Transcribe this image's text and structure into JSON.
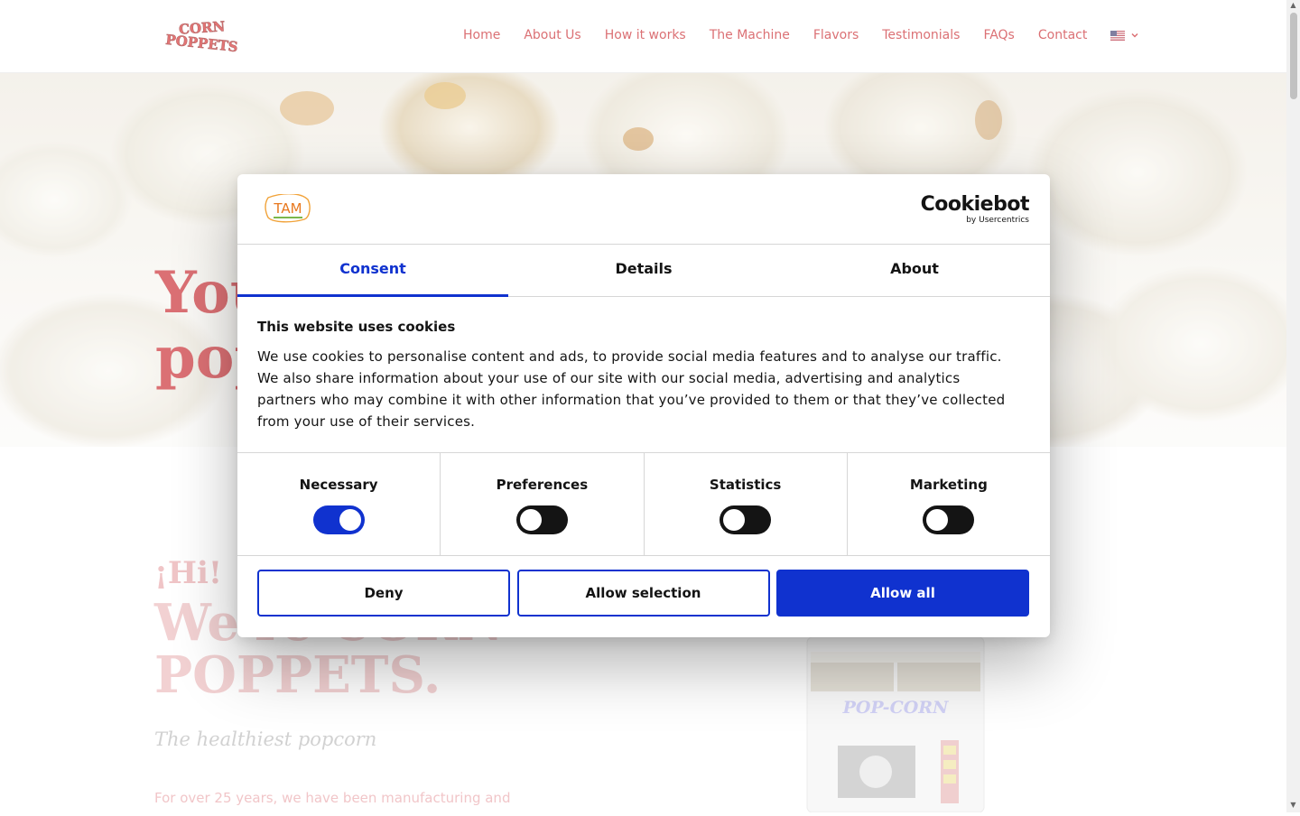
{
  "header": {
    "logo_text": "CORN POPPETS",
    "nav": [
      "Home",
      "About Us",
      "How it works",
      "The Machine",
      "Flavors",
      "Testimonials",
      "FAQs",
      "Contact"
    ],
    "language_flag": "us-flag-icon"
  },
  "hero": {
    "title_line1": "You",
    "title_line2": "pop"
  },
  "intro": {
    "greeting": "¡Hi!",
    "headline_line1": "We're CORN",
    "headline_line2": "POPPETS.",
    "tagline": "The healthiest popcorn",
    "lead": "For over 25 years, we have been manufacturing and",
    "machine_sign": "POP-CORN"
  },
  "cookie_dialog": {
    "brand_logo": "TAM",
    "provider": "Cookiebot",
    "provider_sub": "by Usercentrics",
    "tabs": [
      {
        "label": "Consent",
        "active": true
      },
      {
        "label": "Details",
        "active": false
      },
      {
        "label": "About",
        "active": false
      }
    ],
    "title": "This website uses cookies",
    "text": "We use cookies to personalise content and ads, to provide social media features and to analyse our traffic. We also share information about your use of our site with our social media, advertising and analytics partners who may combine it with other information that you’ve provided to them or that they’ve collected from your use of their services.",
    "categories": [
      {
        "label": "Necessary",
        "enabled": true
      },
      {
        "label": "Preferences",
        "enabled": false
      },
      {
        "label": "Statistics",
        "enabled": false
      },
      {
        "label": "Marketing",
        "enabled": false
      }
    ],
    "buttons": {
      "deny": "Deny",
      "allow_selection": "Allow selection",
      "allow_all": "Allow all"
    }
  },
  "colors": {
    "brand_red": "#c8242a",
    "cookiebot_blue": "#1032cf"
  }
}
